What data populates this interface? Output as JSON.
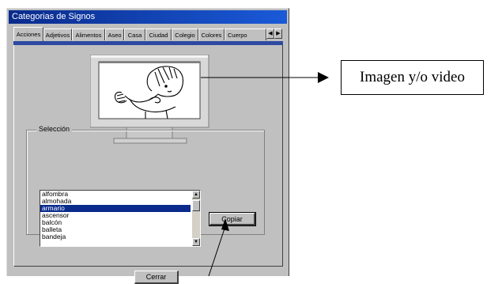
{
  "window": {
    "title": "Categorias de Signos"
  },
  "tabs": [
    {
      "label": "Acciones",
      "active": true
    },
    {
      "label": "Adjetivos",
      "active": false
    },
    {
      "label": "Alimentos",
      "active": false
    },
    {
      "label": "Aseo",
      "active": false
    },
    {
      "label": "Casa",
      "active": false
    },
    {
      "label": "Ciudad",
      "active": false
    },
    {
      "label": "Colegio",
      "active": false
    },
    {
      "label": "Colores",
      "active": false
    },
    {
      "label": "Cuerpo",
      "active": false
    }
  ],
  "tab_scroll": {
    "left_icon": "arrow-left-icon",
    "right_icon": "arrow-right-icon"
  },
  "selection": {
    "legend": "Selección",
    "items": [
      "alfombra",
      "almohada",
      "armario",
      "ascensor",
      "balcón",
      "balleta",
      "bandeja"
    ],
    "selected_index": 2
  },
  "buttons": {
    "copy": "Copiar",
    "close": "Cerrar"
  },
  "annotation": {
    "label": "Imagen y/o video"
  },
  "colors": {
    "titlebar": "#0a2b8c",
    "tab_underline": "#2d4aa0",
    "selection": "#0a2b8c",
    "window": "#c0c0c0"
  }
}
